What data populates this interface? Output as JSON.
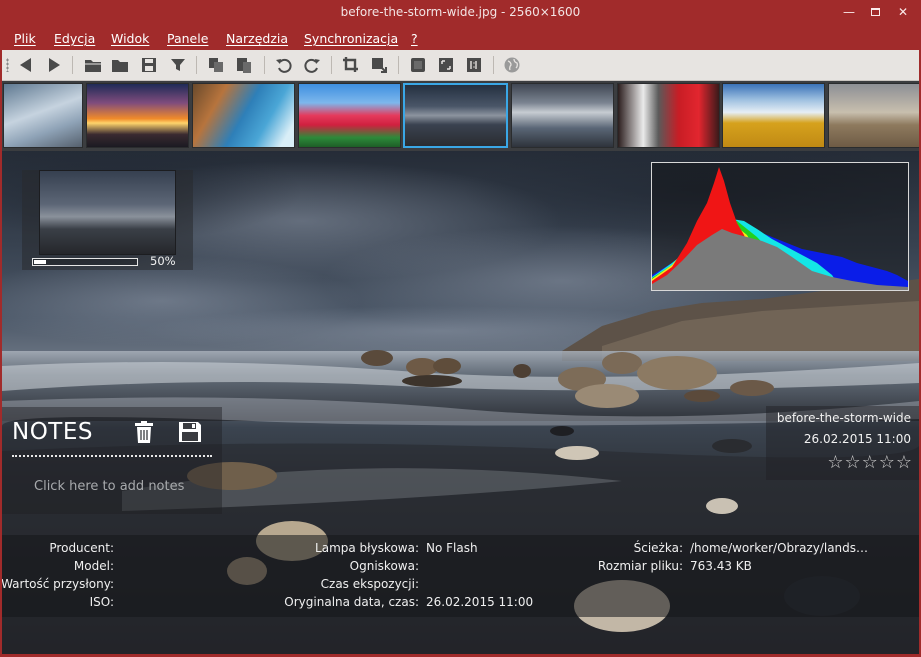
{
  "window": {
    "title": "before-the-storm-wide.jpg - 2560×1600",
    "controls": {
      "minimize": "—",
      "close": "✕"
    }
  },
  "menu": [
    "Plik",
    "Edycja",
    "Widok",
    "Panele",
    "Narzędzia",
    "Synchronizacja",
    "?"
  ],
  "toolbar": {
    "buttons": [
      "arrow-left-icon",
      "arrow-right-icon",
      "open-folder-icon",
      "folder-icon",
      "save-icon",
      "filter-icon",
      "copy-icon",
      "paste-icon",
      "rotate-left-icon",
      "rotate-right-icon",
      "crop-icon",
      "resize-icon",
      "fit-window-icon",
      "fullscreen-icon",
      "original-size-icon",
      "globe-icon"
    ]
  },
  "thumbnails": [
    {
      "name": "winter-owl",
      "colors": [
        "#8aa3bd",
        "#c9d6e2",
        "#6d7f92"
      ]
    },
    {
      "name": "sunset",
      "colors": [
        "#2b3a6e",
        "#f08a2a",
        "#ffd36b"
      ]
    },
    {
      "name": "coast-waterfall",
      "colors": [
        "#2e7fb8",
        "#4aa6d6",
        "#b7743d"
      ]
    },
    {
      "name": "tulips",
      "colors": [
        "#3e8fe0",
        "#e53a5c",
        "#2d8a3a"
      ]
    },
    {
      "name": "before-the-storm-wide",
      "colors": [
        "#2f3a4b",
        "#8c949f",
        "#2a2c31"
      ]
    },
    {
      "name": "sky-clouds",
      "colors": [
        "#5a6676",
        "#c7ccd2",
        "#3f4652"
      ]
    },
    {
      "name": "wine-glasses",
      "colors": [
        "#2b1e1e",
        "#c81d25",
        "#eaeaea"
      ]
    },
    {
      "name": "wheat-field",
      "colors": [
        "#3a72b8",
        "#e6eef5",
        "#d6a21d"
      ]
    },
    {
      "name": "ruins",
      "colors": [
        "#8d8f95",
        "#c8bfae",
        "#6e5b45"
      ]
    }
  ],
  "navigator": {
    "zoom_label": "50%",
    "zoom_fraction": 0.12
  },
  "notes": {
    "title": "NOTES",
    "placeholder": "Click here to add notes"
  },
  "file_info": {
    "name": "before-the-storm-wide",
    "date": "26.02.2015 11:00",
    "rating": "☆☆☆☆☆"
  },
  "exif": {
    "col1": [
      {
        "label": "Producent:",
        "value": ""
      },
      {
        "label": "Model:",
        "value": ""
      },
      {
        "label": "Wartość przysłony:",
        "value": ""
      },
      {
        "label": "ISO:",
        "value": ""
      }
    ],
    "col2": [
      {
        "label": "Lampa błyskowa:",
        "value": "No Flash"
      },
      {
        "label": "Ogniskowa:",
        "value": ""
      },
      {
        "label": "Czas ekspozycji:",
        "value": ""
      },
      {
        "label": "Oryginalna data, czas:",
        "value": "26.02.2015 11:00"
      }
    ],
    "col3": [
      {
        "label": "Ścieżka:",
        "value": "/home/worker/Obrazy/lands…"
      },
      {
        "label": "Rozmiar pliku:",
        "value": "763.43 KB"
      }
    ]
  },
  "colors": {
    "frame": "#a12b2b",
    "selection": "#3aa7e6",
    "toolbar": "#e7e4e1"
  }
}
